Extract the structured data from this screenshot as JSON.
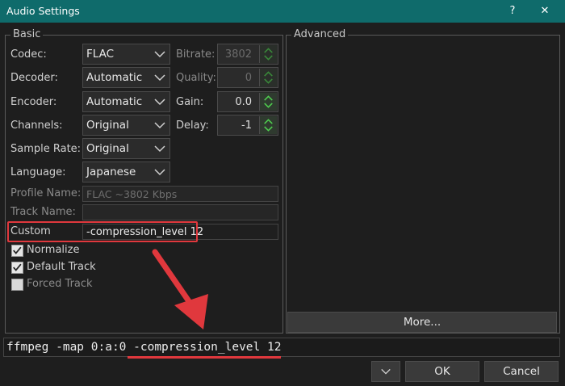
{
  "window": {
    "title": "Audio Settings",
    "help_label": "?",
    "close_label": "✕"
  },
  "basic": {
    "group_label": "Basic",
    "codec": {
      "label": "Codec:",
      "value": "FLAC"
    },
    "decoder": {
      "label": "Decoder:",
      "value": "Automatic"
    },
    "encoder": {
      "label": "Encoder:",
      "value": "Automatic"
    },
    "channels": {
      "label": "Channels:",
      "value": "Original"
    },
    "sample_rate": {
      "label": "Sample Rate:",
      "value": "Original"
    },
    "language": {
      "label": "Language:",
      "value": "Japanese"
    },
    "bitrate": {
      "label": "Bitrate:",
      "value": "3802"
    },
    "quality": {
      "label": "Quality:",
      "value": "0"
    },
    "gain": {
      "label": "Gain:",
      "value": "0.0"
    },
    "delay": {
      "label": "Delay:",
      "value": "-1"
    },
    "profile_name": {
      "label": "Profile Name:",
      "value": "FLAC ~3802 Kbps"
    },
    "track_name": {
      "label": "Track Name:",
      "value": ""
    },
    "custom": {
      "label": "Custom",
      "value": "-compression_level 12"
    },
    "normalize": {
      "label": "Normalize",
      "checked": true
    },
    "default_track": {
      "label": "Default Track",
      "checked": true
    },
    "forced_track": {
      "label": "Forced Track",
      "checked": false
    }
  },
  "advanced": {
    "group_label": "Advanced",
    "more_label": "More..."
  },
  "command_line": "ffmpeg -map 0:a:0 -compression_level 12",
  "footer": {
    "ok_label": "OK",
    "cancel_label": "Cancel"
  },
  "colors": {
    "titlebar": "#0f6b6b",
    "highlight": "#e0383d",
    "spinner_arrow": "#3fbf3f"
  },
  "icons": {
    "help": "question-mark",
    "close": "x-mark",
    "combo_arrow": "chevron-down",
    "spin": "up-down-arrows",
    "check": "checkmark",
    "annotation": "red-arrow"
  }
}
